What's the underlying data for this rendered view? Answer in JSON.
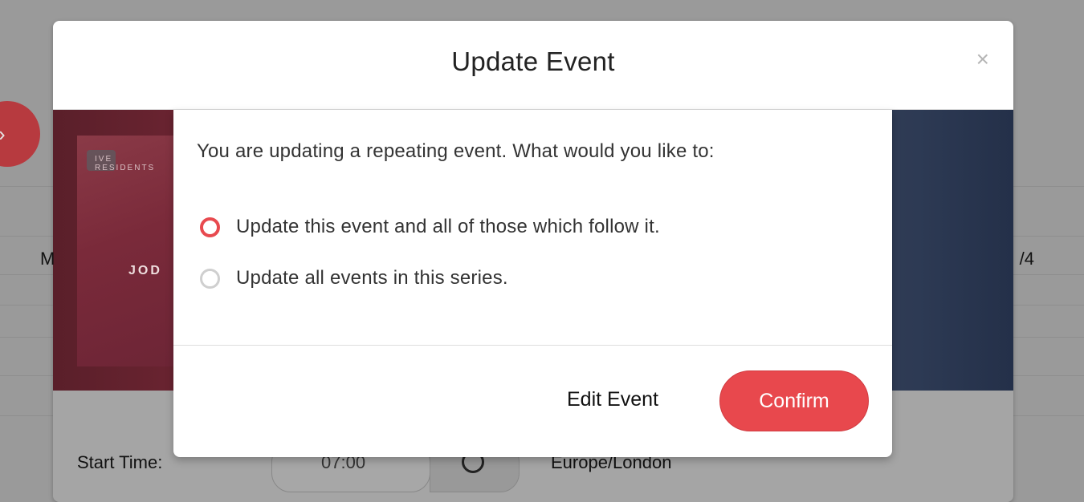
{
  "dialog": {
    "title": "Update Event",
    "close_glyph": "×",
    "question": "You are updating a repeating event. What would you like to:",
    "options": [
      {
        "label": "Update this event and all of those which follow it.",
        "selected": true
      },
      {
        "label": "Update all events in this series.",
        "selected": false
      }
    ],
    "edit_label": "Edit Event",
    "confirm_label": "Confirm"
  },
  "background": {
    "side_left": "M",
    "side_right": "/4",
    "poster_text_top": "IVE\nRESIDENTS",
    "poster_text_main": "JOD",
    "start_time_label": "Start Time:",
    "start_time_value": "07:00",
    "timezone": "Europe/London",
    "fab_glyph": "›"
  },
  "colors": {
    "accent": "#e8484d",
    "radio_unselected": "#cfcfcf",
    "overlay": "#9a9a9a"
  }
}
